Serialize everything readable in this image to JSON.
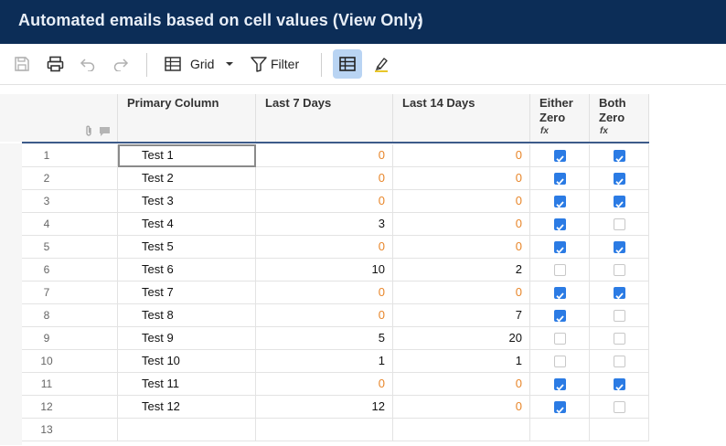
{
  "title": "Automated emails based on cell values (View Only)",
  "title_menu_icon": "⋮",
  "toolbar": {
    "view_label": "Grid",
    "filter_label": "Filter"
  },
  "columns": {
    "primary": "Primary Column",
    "last7": "Last 7 Days",
    "last14": "Last 14 Days",
    "either_l1": "Either",
    "either_l2": "Zero",
    "both_l1": "Both",
    "both_l2": "Zero",
    "formula_icon": "fx"
  },
  "rows": [
    {
      "num": "1",
      "name": "Test 1",
      "d7": "0",
      "d14": "0",
      "either": true,
      "both": true
    },
    {
      "num": "2",
      "name": "Test 2",
      "d7": "0",
      "d14": "0",
      "either": true,
      "both": true
    },
    {
      "num": "3",
      "name": "Test 3",
      "d7": "0",
      "d14": "0",
      "either": true,
      "both": true
    },
    {
      "num": "4",
      "name": "Test 4",
      "d7": "3",
      "d14": "0",
      "either": true,
      "both": false
    },
    {
      "num": "5",
      "name": "Test 5",
      "d7": "0",
      "d14": "0",
      "either": true,
      "both": true
    },
    {
      "num": "6",
      "name": "Test 6",
      "d7": "10",
      "d14": "2",
      "either": false,
      "both": false
    },
    {
      "num": "7",
      "name": "Test 7",
      "d7": "0",
      "d14": "0",
      "either": true,
      "both": true
    },
    {
      "num": "8",
      "name": "Test 8",
      "d7": "0",
      "d14": "7",
      "either": true,
      "both": false
    },
    {
      "num": "9",
      "name": "Test 9",
      "d7": "5",
      "d14": "20",
      "either": false,
      "both": false
    },
    {
      "num": "10",
      "name": "Test 10",
      "d7": "1",
      "d14": "1",
      "either": false,
      "both": false
    },
    {
      "num": "11",
      "name": "Test 11",
      "d7": "0",
      "d14": "0",
      "either": true,
      "both": true
    },
    {
      "num": "12",
      "name": "Test 12",
      "d7": "12",
      "d14": "0",
      "either": true,
      "both": false
    },
    {
      "num": "13",
      "name": "",
      "d7": "",
      "d14": "",
      "either": null,
      "both": null
    }
  ],
  "colors": {
    "title_bar": "#0c2d57",
    "zero_value": "#e8862a",
    "checked": "#2b7be4",
    "active_view": "#b9d4f3"
  }
}
